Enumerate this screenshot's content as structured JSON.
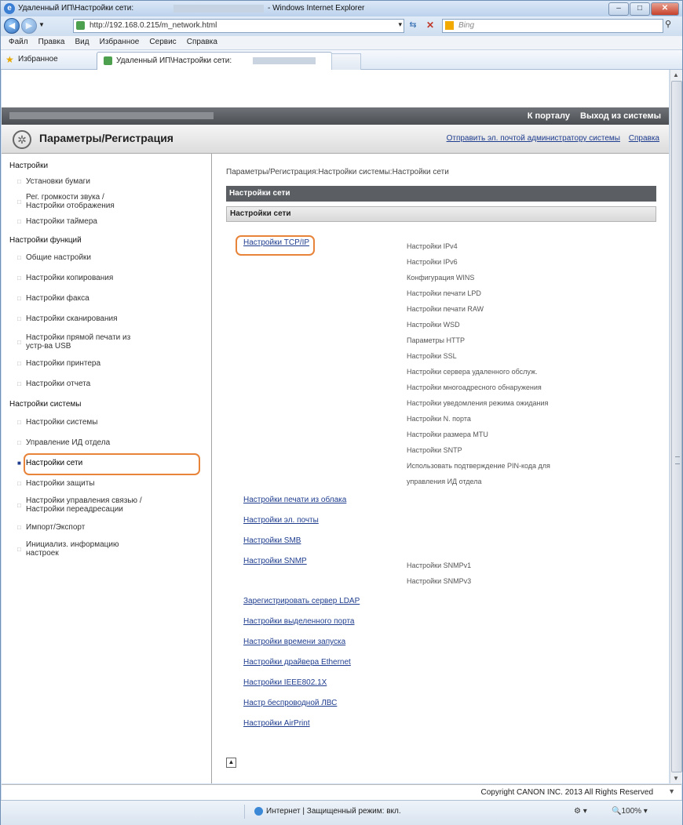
{
  "window": {
    "title_prefix": "Удаленный ИП\\Настройки сети:",
    "title_suffix": "- Windows Internet Explorer",
    "min": "–",
    "max": "□",
    "close": "✕"
  },
  "address": {
    "url": "http://192.168.0.215/m_network.html",
    "search_placeholder": "Bing"
  },
  "menu": [
    "Файл",
    "Правка",
    "Вид",
    "Избранное",
    "Сервис",
    "Справка"
  ],
  "favorites": {
    "label": "Избранное",
    "tab_label": "Удаленный ИП\\Настройки сети:"
  },
  "portal": {
    "links": [
      "К порталу",
      "Выход из системы"
    ],
    "title": "Параметры/Регистрация",
    "header_links": [
      "Отправить эл. почтой администратору системы",
      "Справка"
    ]
  },
  "sidebar": {
    "section1": "Настройки",
    "s1_items": [
      "Установки бумаги",
      "Рег. громкости звука /",
      "Настройки отображения",
      "Настройки таймера"
    ],
    "section2": "Настройки функций",
    "s2_items": [
      "Общие настройки",
      "Настройки копирования",
      "Настройки факса",
      "Настройки сканирования",
      "Настройки прямой печати из",
      "устр-ва USB",
      "Настройки принтера",
      "Настройки отчета"
    ],
    "section3": "Настройки системы",
    "s3_items": [
      "Настройки системы",
      "Управление ИД отдела",
      "Настройки сети",
      "Настройки защиты",
      "Настройки управления связью /",
      "Настройки переадресации",
      "Импорт/Экспорт",
      "Инициализ. информацию",
      "настроек"
    ]
  },
  "main": {
    "breadcrumb": "Параметры/Регистрация:Настройки системы:Настройки сети",
    "header": "Настройки сети",
    "subheader": "Настройки сети",
    "tcpip": "Настройки TCP/IP",
    "tcpip_sub": [
      "Настройки IPv4",
      "Настройки IPv6",
      "Конфигурация WINS",
      "Настройки печати LPD",
      "Настройки печати RAW",
      "Настройки WSD",
      "Параметры HTTP",
      "Настройки SSL",
      "Настройки сервера удаленного обслуж.",
      "Настройки многоадресного обнаружения",
      "Настройки уведомления режима ожидания",
      "Настройки N. порта",
      "Настройки размера MTU",
      "Настройки SNTP",
      "Использовать подтверждение PIN-кода для",
      "управления ИД отдела"
    ],
    "links_a": [
      "Настройки печати из облака",
      "Настройки эл. почты",
      "Настройки SMB",
      "Настройки SNMP"
    ],
    "snmp_sub": [
      "Настройки SNMPv1",
      "Настройки SNMPv3"
    ],
    "links_b": [
      "Зарегистрировать сервер LDAP",
      "Настройки выделенного порта",
      "Настройки времени запуска",
      "Настройки драйвера Ethernet",
      "Настройки IEEE802.1X",
      "Настр беспроводной ЛВС",
      "Настройки AirPrint"
    ]
  },
  "footer": {
    "copyright": "Copyright CANON INC. 2013 All Rights Reserved",
    "zone": "Интернет | Защищенный режим: вкл.",
    "zoom": "100%"
  }
}
